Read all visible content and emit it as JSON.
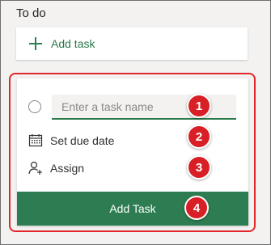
{
  "section": {
    "title": "To do"
  },
  "add_task_row": {
    "label": "Add task",
    "icon": "plus-icon"
  },
  "form": {
    "task_input_placeholder": "Enter a task name",
    "due_date_label": "Set due date",
    "assign_label": "Assign",
    "submit_label": "Add Task"
  },
  "badges": [
    "1",
    "2",
    "3",
    "4"
  ],
  "colors": {
    "accent_green": "#2e7d52",
    "highlight_red": "#e2262b",
    "badge_red": "#d81f26"
  }
}
